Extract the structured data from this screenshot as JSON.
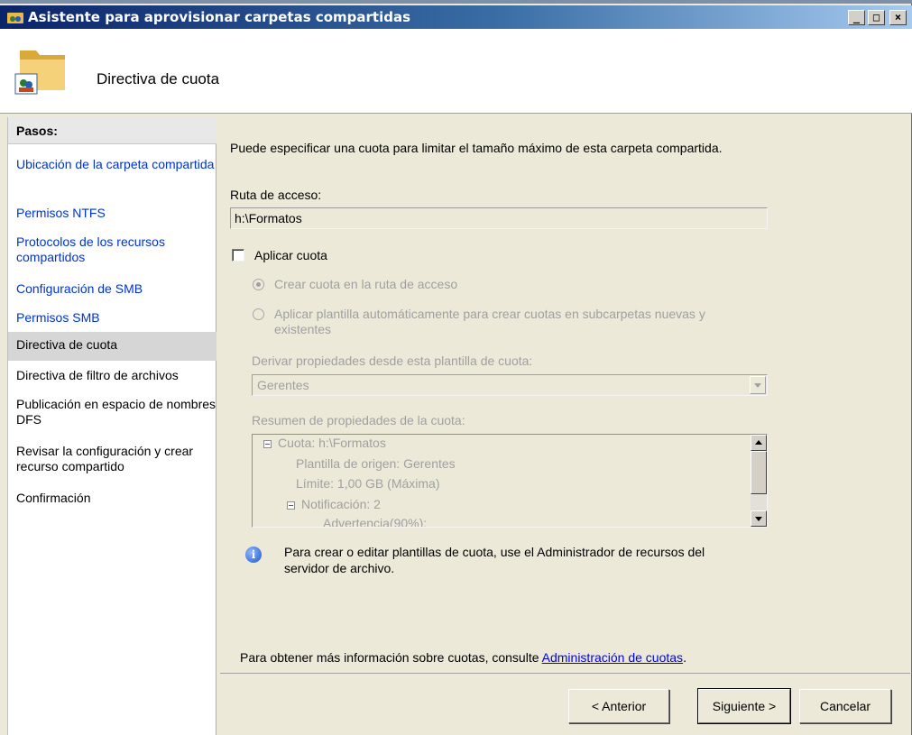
{
  "window": {
    "title": "Asistente para aprovisionar carpetas compartidas"
  },
  "header": {
    "page_title": "Directiva de cuota"
  },
  "steps": {
    "title": "Pasos:",
    "items": [
      {
        "label": "Ubicación de la carpeta compartida",
        "state": "link"
      },
      {
        "label": "Permisos NTFS",
        "state": "link"
      },
      {
        "label": "Protocolos de los recursos compartidos",
        "state": "link"
      },
      {
        "label": "Configuración de SMB",
        "state": "link"
      },
      {
        "label": "Permisos SMB",
        "state": "link"
      },
      {
        "label": "Directiva de cuota",
        "state": "current"
      },
      {
        "label": "Directiva de filtro de archivos",
        "state": "normal"
      },
      {
        "label": "Publicación en espacio de nombres DFS",
        "state": "normal"
      },
      {
        "label": "Revisar la configuración y crear recurso compartido",
        "state": "normal"
      },
      {
        "label": "Confirmación",
        "state": "normal"
      }
    ]
  },
  "main": {
    "intro": "Puede especificar una cuota para limitar el tamaño máximo de esta carpeta compartida.",
    "path_label": "Ruta de acceso:",
    "path_value": "h:\\Formatos",
    "apply_quota_label": "Aplicar cuota",
    "apply_quota_checked": false,
    "radio_create": "Crear cuota en la ruta de acceso",
    "radio_auto_line1": "Aplicar plantilla automáticamente para crear cuotas en subcarpetas nuevas y",
    "radio_auto_line2": "existentes",
    "template_label": "Derivar propiedades desde esta plantilla de cuota:",
    "template_value": "Gerentes",
    "summary_label": "Resumen de propiedades de la cuota:",
    "tree": {
      "root": "Cuota: h:\\Formatos",
      "source": "Plantilla de origen: Gerentes",
      "limit": "Límite: 1,00 GB (Máxima)",
      "notification": "Notificación: 2",
      "warning": "Advertencia(90%):"
    },
    "info_line1": "Para crear o editar plantillas de cuota, use el Administrador de recursos del",
    "info_line2": "servidor de archivo.",
    "more_info_text": "Para obtener más información sobre cuotas, consulte",
    "more_info_link": "Administración de cuotas",
    "more_info_end": "."
  },
  "buttons": {
    "back": "< Anterior",
    "next": "Siguiente >",
    "cancel": "Cancelar"
  },
  "colors": {
    "link": "#0033cc",
    "titlebar": "#0a246a",
    "disabled": "#a0a0a0"
  }
}
